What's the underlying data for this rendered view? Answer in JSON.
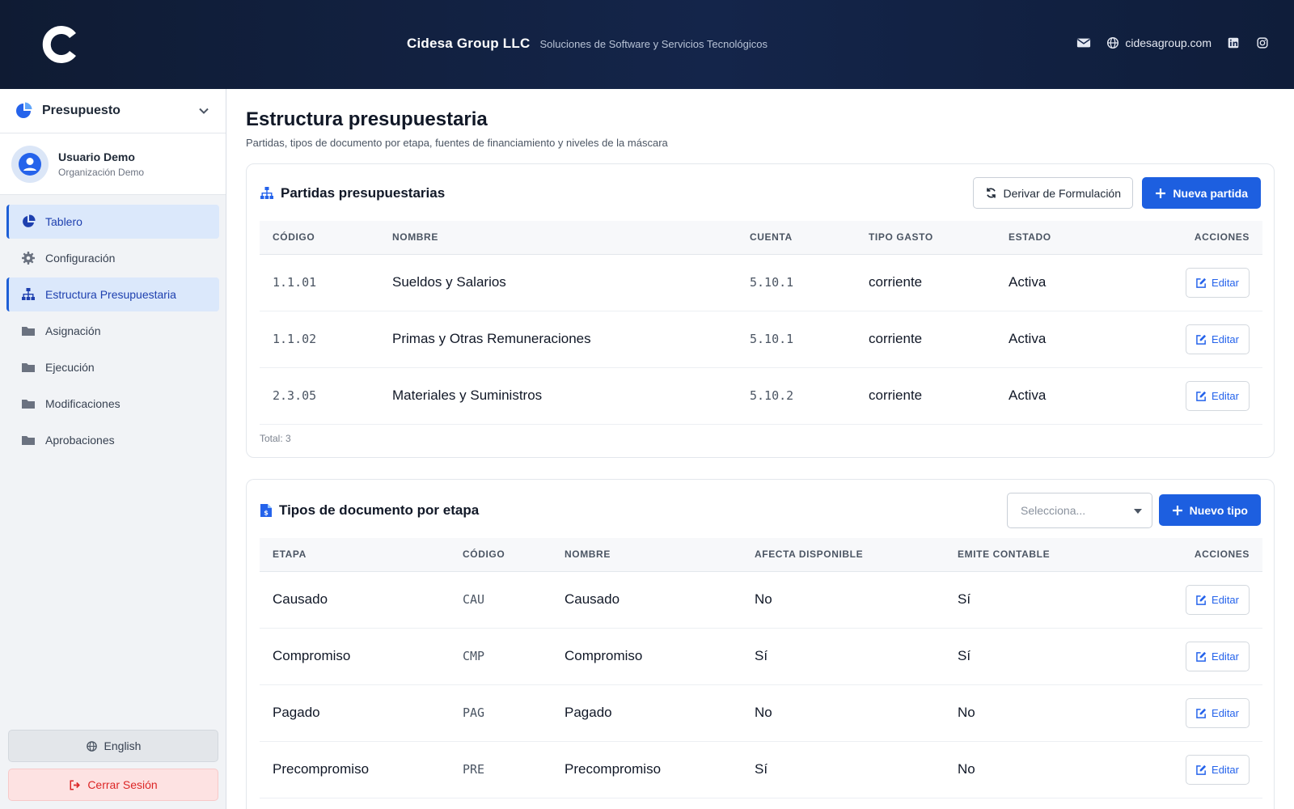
{
  "header": {
    "brand_name": "Cidesa Group LLC",
    "tagline": "Soluciones de Software y Servicios Tecnológicos",
    "website": "cidesagroup.com",
    "icons": [
      "mail-icon",
      "globe-icon",
      "linkedin-icon",
      "instagram-icon"
    ]
  },
  "sidebar": {
    "module": "Presupuesto",
    "user": {
      "name": "Usuario Demo",
      "org": "Organización Demo"
    },
    "items": [
      {
        "label": "Tablero",
        "icon": "pie-chart-icon",
        "active": true
      },
      {
        "label": "Configuración",
        "icon": "gear-icon",
        "active": false
      },
      {
        "label": "Estructura Presupuestaria",
        "icon": "sitemap-icon",
        "active": true
      },
      {
        "label": "Asignación",
        "icon": "folder-icon",
        "active": false
      },
      {
        "label": "Ejecución",
        "icon": "folder-icon",
        "active": false
      },
      {
        "label": "Modificaciones",
        "icon": "folder-icon",
        "active": false
      },
      {
        "label": "Aprobaciones",
        "icon": "folder-icon",
        "active": false
      }
    ],
    "language_label": "English",
    "logout_label": "Cerrar Sesión"
  },
  "page": {
    "title": "Estructura presupuestaria",
    "subtitle": "Partidas, tipos de documento por etapa, fuentes de financiamiento y niveles de la máscara"
  },
  "partidas": {
    "title": "Partidas presupuestarias",
    "derive_label": "Derivar de Formulación",
    "new_label": "Nueva partida",
    "columns": [
      "CÓDIGO",
      "NOMBRE",
      "CUENTA",
      "TIPO GASTO",
      "ESTADO",
      "ACCIONES"
    ],
    "rows": [
      {
        "codigo": "1.1.01",
        "nombre": "Sueldos y Salarios",
        "cuenta": "5.10.1",
        "tipo": "corriente",
        "estado": "Activa",
        "accion": "Editar"
      },
      {
        "codigo": "1.1.02",
        "nombre": "Primas y Otras Remuneraciones",
        "cuenta": "5.10.1",
        "tipo": "corriente",
        "estado": "Activa",
        "accion": "Editar"
      },
      {
        "codigo": "2.3.05",
        "nombre": "Materiales y Suministros",
        "cuenta": "5.10.2",
        "tipo": "corriente",
        "estado": "Activa",
        "accion": "Editar"
      }
    ],
    "total": "Total: 3"
  },
  "tipos": {
    "title": "Tipos de documento por etapa",
    "select_placeholder": "Selecciona...",
    "new_label": "Nuevo tipo",
    "columns": [
      "ETAPA",
      "CÓDIGO",
      "NOMBRE",
      "AFECTA DISPONIBLE",
      "EMITE CONTABLE",
      "ACCIONES"
    ],
    "rows": [
      {
        "etapa": "Causado",
        "codigo": "CAU",
        "nombre": "Causado",
        "afecta": "No",
        "emite": "Sí",
        "accion": "Editar"
      },
      {
        "etapa": "Compromiso",
        "codigo": "CMP",
        "nombre": "Compromiso",
        "afecta": "Sí",
        "emite": "Sí",
        "accion": "Editar"
      },
      {
        "etapa": "Pagado",
        "codigo": "PAG",
        "nombre": "Pagado",
        "afecta": "No",
        "emite": "No",
        "accion": "Editar"
      },
      {
        "etapa": "Precompromiso",
        "codigo": "PRE",
        "nombre": "Precompromiso",
        "afecta": "Sí",
        "emite": "No",
        "accion": "Editar"
      }
    ]
  },
  "colors": {
    "primary": "#1d5fe0",
    "header_bg": "#0f1b33",
    "active_nav_bg": "#dbe8fb",
    "danger": "#dc2626"
  }
}
